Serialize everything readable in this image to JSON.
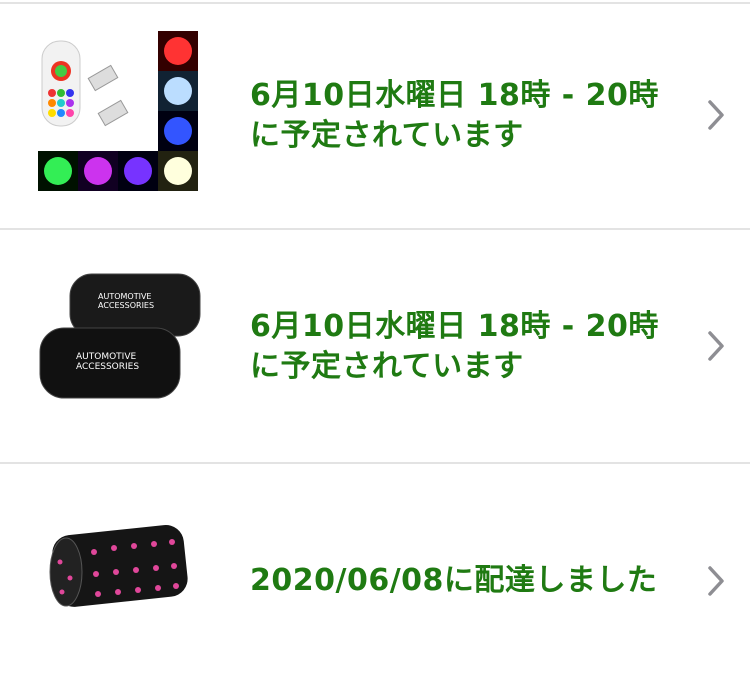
{
  "orders": [
    {
      "status_line1": "6月10日水曜日 18時 - 20時",
      "status_line2": "に予定されています",
      "thumb_icon": "led-bulb-remote-icon"
    },
    {
      "status_line1": "6月10日水曜日 18時 - 20時",
      "status_line2": "に予定されています",
      "thumb_icon": "headrest-pillow-icon",
      "thumb_text": [
        "AUTOMOTIVE",
        "ACCESSORIES"
      ]
    },
    {
      "status_line1": "2020/06/08に配達しました",
      "thumb_icon": "cushion-roll-icon"
    }
  ],
  "colors": {
    "status_green": "#1f7a12",
    "chevron_gray": "#8e8e93",
    "divider": "#e3e3e3"
  }
}
